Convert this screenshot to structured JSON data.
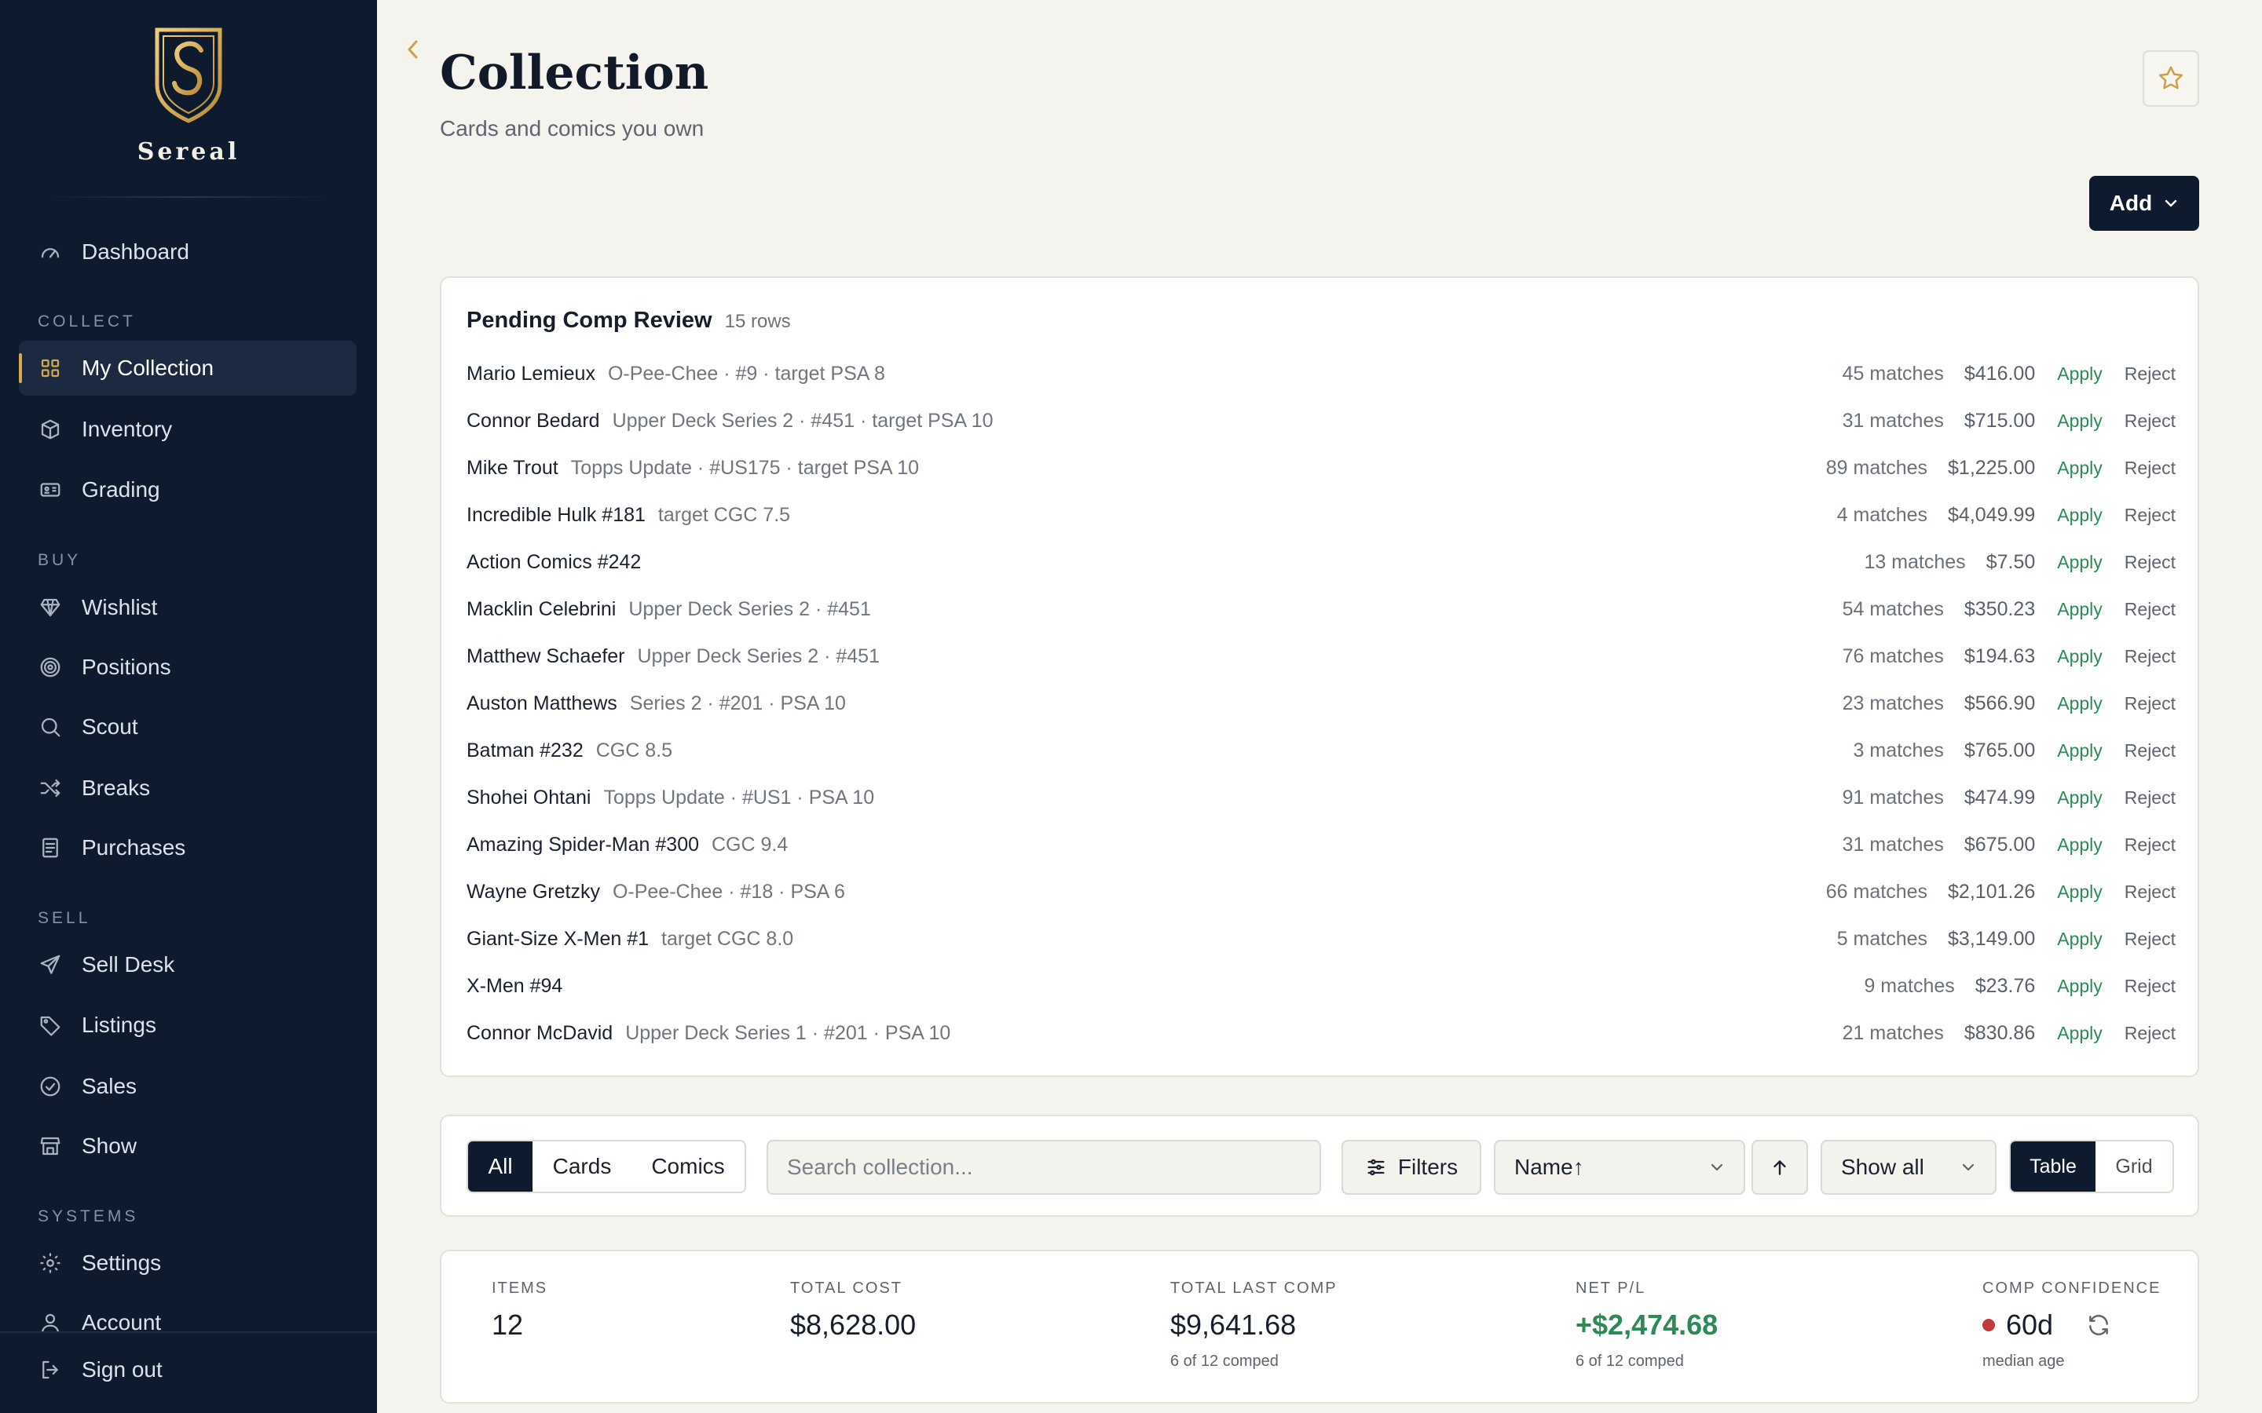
{
  "brand": {
    "name": "Sereal"
  },
  "sidebar": {
    "dashboard": "Dashboard",
    "sections": {
      "collect": "COLLECT",
      "buy": "BUY",
      "sell": "SELL",
      "systems": "SYSTEMS"
    },
    "items": {
      "my_collection": "My Collection",
      "inventory": "Inventory",
      "grading": "Grading",
      "wishlist": "Wishlist",
      "positions": "Positions",
      "scout": "Scout",
      "breaks": "Breaks",
      "purchases": "Purchases",
      "sell_desk": "Sell Desk",
      "listings": "Listings",
      "sales": "Sales",
      "show": "Show",
      "settings": "Settings",
      "account": "Account",
      "sign_out": "Sign out"
    }
  },
  "header": {
    "title": "Collection",
    "subtitle": "Cards and comics you own",
    "add_label": "Add"
  },
  "pending": {
    "title": "Pending Comp Review",
    "count": "15 rows",
    "apply_label": "Apply",
    "reject_label": "Reject",
    "rows": [
      {
        "name": "Mario Lemieux",
        "detail": "O-Pee-Chee · #9 · target PSA 8",
        "matches": "45 matches",
        "price": "$416.00"
      },
      {
        "name": "Connor Bedard",
        "detail": "Upper Deck Series 2 · #451 · target PSA 10",
        "matches": "31 matches",
        "price": "$715.00"
      },
      {
        "name": "Mike Trout",
        "detail": "Topps Update · #US175 · target PSA 10",
        "matches": "89 matches",
        "price": "$1,225.00"
      },
      {
        "name": "Incredible Hulk #181",
        "detail": "target CGC 7.5",
        "matches": "4 matches",
        "price": "$4,049.99"
      },
      {
        "name": "Action Comics #242",
        "detail": "",
        "matches": "13 matches",
        "price": "$7.50"
      },
      {
        "name": "Macklin Celebrini",
        "detail": "Upper Deck Series 2 · #451",
        "matches": "54 matches",
        "price": "$350.23"
      },
      {
        "name": "Matthew Schaefer",
        "detail": "Upper Deck Series 2 · #451",
        "matches": "76 matches",
        "price": "$194.63"
      },
      {
        "name": "Auston Matthews",
        "detail": "Series 2 · #201 · PSA 10",
        "matches": "23 matches",
        "price": "$566.90"
      },
      {
        "name": "Batman #232",
        "detail": "CGC 8.5",
        "matches": "3 matches",
        "price": "$765.00"
      },
      {
        "name": "Shohei Ohtani",
        "detail": "Topps Update · #US1 · PSA 10",
        "matches": "91 matches",
        "price": "$474.99"
      },
      {
        "name": "Amazing Spider-Man #300",
        "detail": "CGC 9.4",
        "matches": "31 matches",
        "price": "$675.00"
      },
      {
        "name": "Wayne Gretzky",
        "detail": "O-Pee-Chee · #18 · PSA 6",
        "matches": "66 matches",
        "price": "$2,101.26"
      },
      {
        "name": "Giant-Size X-Men #1",
        "detail": "target CGC 8.0",
        "matches": "5 matches",
        "price": "$3,149.00"
      },
      {
        "name": "X-Men #94",
        "detail": "",
        "matches": "9 matches",
        "price": "$23.76"
      },
      {
        "name": "Connor McDavid",
        "detail": "Upper Deck Series 1 · #201 · PSA 10",
        "matches": "21 matches",
        "price": "$830.86"
      }
    ]
  },
  "toolbar": {
    "segments": [
      "All",
      "Cards",
      "Comics"
    ],
    "search_placeholder": "Search collection...",
    "filters_label": "Filters",
    "sort_value": "Name↑",
    "show_value": "Show all",
    "view_table": "Table",
    "view_grid": "Grid"
  },
  "stats": {
    "items": {
      "label": "ITEMS",
      "value": "12"
    },
    "total_cost": {
      "label": "TOTAL COST",
      "value": "$8,628.00"
    },
    "total_last_comp": {
      "label": "TOTAL LAST COMP",
      "value": "$9,641.68",
      "sub": "6 of 12 comped"
    },
    "net_pl": {
      "label": "NET P/L",
      "value": "+$2,474.68",
      "sub": "6 of 12 comped"
    },
    "comp_confidence": {
      "label": "COMP CONFIDENCE",
      "value": "60d",
      "sub": "median age"
    }
  },
  "colors": {
    "accent_gold": "#d7a84c",
    "navy": "#0e1a2d",
    "positive": "#2b8a55",
    "negative": "#c23a3a"
  }
}
